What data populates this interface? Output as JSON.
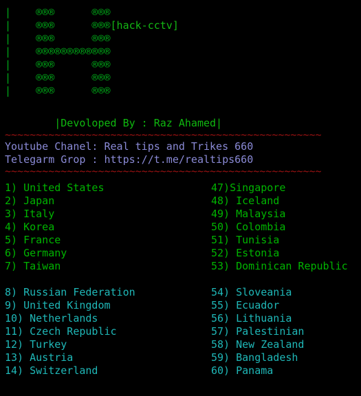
{
  "terminal": {
    "background_color": "#000000",
    "title_tag": "[hack-cctv]"
  },
  "banner": {
    "icon_name": "ascii-art-letter-h",
    "glyph": "®",
    "lines": [
      "|    ®®®      ®®®",
      "|    ®®®      ®®®",
      "|    ®®®      ®®®",
      "|    ®®®®®®®®®®®®",
      "|    ®®®      ®®®",
      "|    ®®®      ®®®",
      "|    ®®®      ®®®"
    ],
    "color": "#00a818"
  },
  "credits": {
    "developer_line": "        |Devoloped By : Raz Ahamed|",
    "developer_color": "#0fb80f",
    "separator_top": "~~~~~~~~~~~~~~~~~~~~~~~~~~~~~~~~~~~~~~~~~~~~~~~~~~~",
    "separator_bottom": "~~~~~~~~~~~~~~~~~~~~~~~~~~~~~~~~~~~~~~~~~~~~~~~~~~~",
    "separator_color": "#9c1212",
    "youtube_line": "Youtube Chanel: Real tips and Trikes 660",
    "telegram_line": "Telegarm Grop : https://t.me/realtips660",
    "info_color": "#8a8ad6"
  },
  "country_list": {
    "green_color": "#00b400",
    "cyan_color": "#1fb8b8",
    "block_green": [
      {
        "left": "1) United States",
        "right": "47)Singapore"
      },
      {
        "left": "2) Japan",
        "right": "48) Iceland"
      },
      {
        "left": "3) Italy",
        "right": "49) Malaysia"
      },
      {
        "left": "4) Korea",
        "right": "50) Colombia"
      },
      {
        "left": "5) France",
        "right": "51) Tunisia"
      },
      {
        "left": "6) Germany",
        "right": "52) Estonia"
      },
      {
        "left": "7) Taiwan",
        "right": "53) Dominican Republic"
      }
    ],
    "block_cyan": [
      {
        "left": "8) Russian Federation",
        "right": "54) Sloveania"
      },
      {
        "left": "9) United Kingdom",
        "right": "55) Ecuador"
      },
      {
        "left": "10) Netherlands",
        "right": "56) Lithuania"
      },
      {
        "left": "11) Czech Republic",
        "right": "57) Palestinian"
      },
      {
        "left": "12) Turkey",
        "right": "58) New Zealand"
      },
      {
        "left": "13) Austria",
        "right": "59) Bangladesh"
      },
      {
        "left": "14) Switzerland",
        "right": "60) Panama"
      }
    ]
  }
}
